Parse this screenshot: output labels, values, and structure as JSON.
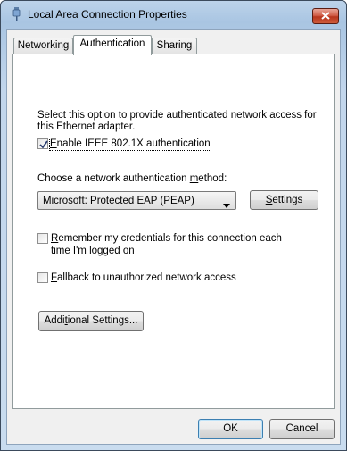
{
  "window": {
    "title": "Local Area Connection Properties"
  },
  "tabs": [
    {
      "label": "Networking",
      "active": false
    },
    {
      "label": "Authentication",
      "active": true
    },
    {
      "label": "Sharing",
      "active": false
    }
  ],
  "auth": {
    "description_line1": "Select this option to provide authenticated network access for",
    "description_line2": "this Ethernet adapter.",
    "enable_8021x": {
      "label_access_key": "E",
      "label_rest": "nable IEEE 802.1X authentication",
      "checked": true
    },
    "method_label_pre": "Choose a network authentication ",
    "method_label_key": "m",
    "method_label_post": "ethod:",
    "method_selected": "Microsoft: Protected EAP (PEAP)",
    "settings_key": "S",
    "settings_rest": "ettings",
    "remember": {
      "label_access_key": "R",
      "label_line1_rest": "emember my credentials for this connection each",
      "label_line2": "time I'm logged on",
      "checked": false
    },
    "fallback": {
      "label_access_key": "F",
      "label_rest": "allback to unauthorized network access",
      "checked": false
    },
    "additional_pre": "Addi",
    "additional_key": "t",
    "additional_post": "ional Settings..."
  },
  "footer": {
    "ok_label": "OK",
    "cancel_label": "Cancel"
  }
}
